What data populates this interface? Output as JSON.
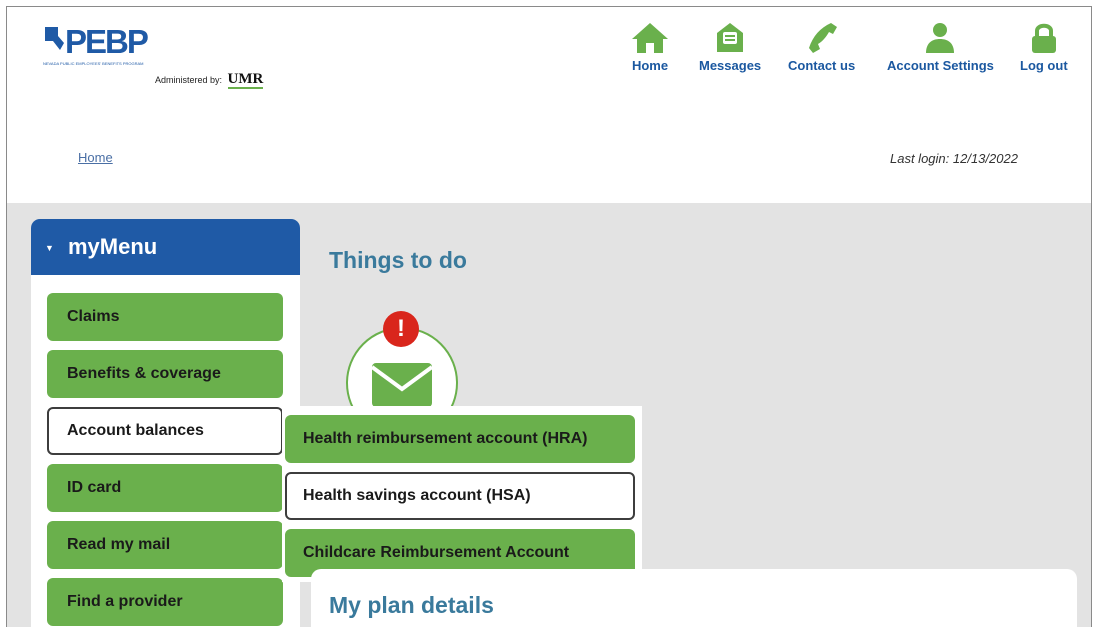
{
  "header": {
    "logo_text": "PEBP",
    "logo_tagline": "NEVADA PUBLIC EMPLOYEES' BENEFITS PROGRAM",
    "administered_label": "Administered by:",
    "administrator": "UMR"
  },
  "nav": [
    {
      "label": "Home",
      "icon": "home-icon"
    },
    {
      "label": "Messages",
      "icon": "envelope-icon"
    },
    {
      "label": "Contact us",
      "icon": "phone-icon"
    },
    {
      "label": "Account Settings",
      "icon": "user-icon"
    },
    {
      "label": "Log out",
      "icon": "lock-icon"
    }
  ],
  "breadcrumb": {
    "home": "Home"
  },
  "last_login": "Last login: 12/13/2022",
  "sidebar": {
    "title": "myMenu",
    "items": [
      {
        "label": "Claims"
      },
      {
        "label": "Benefits & coverage"
      },
      {
        "label": "Account balances",
        "active": true
      },
      {
        "label": "ID card"
      },
      {
        "label": "Read my mail"
      },
      {
        "label": "Find a provider"
      }
    ]
  },
  "submenu": {
    "items": [
      {
        "label": "Health reimbursement account (HRA)"
      },
      {
        "label": "Health savings account (HSA)",
        "active": true
      },
      {
        "label": "Childcare Reimbursement Account"
      }
    ]
  },
  "main": {
    "things_title": "Things to do",
    "alert_symbol": "!",
    "plan_title": "My plan details"
  },
  "colors": {
    "brand_blue": "#1f5aa6",
    "nav_green": "#6ab04c",
    "heading_teal": "#3a7a9c",
    "alert_red": "#d9261c"
  }
}
